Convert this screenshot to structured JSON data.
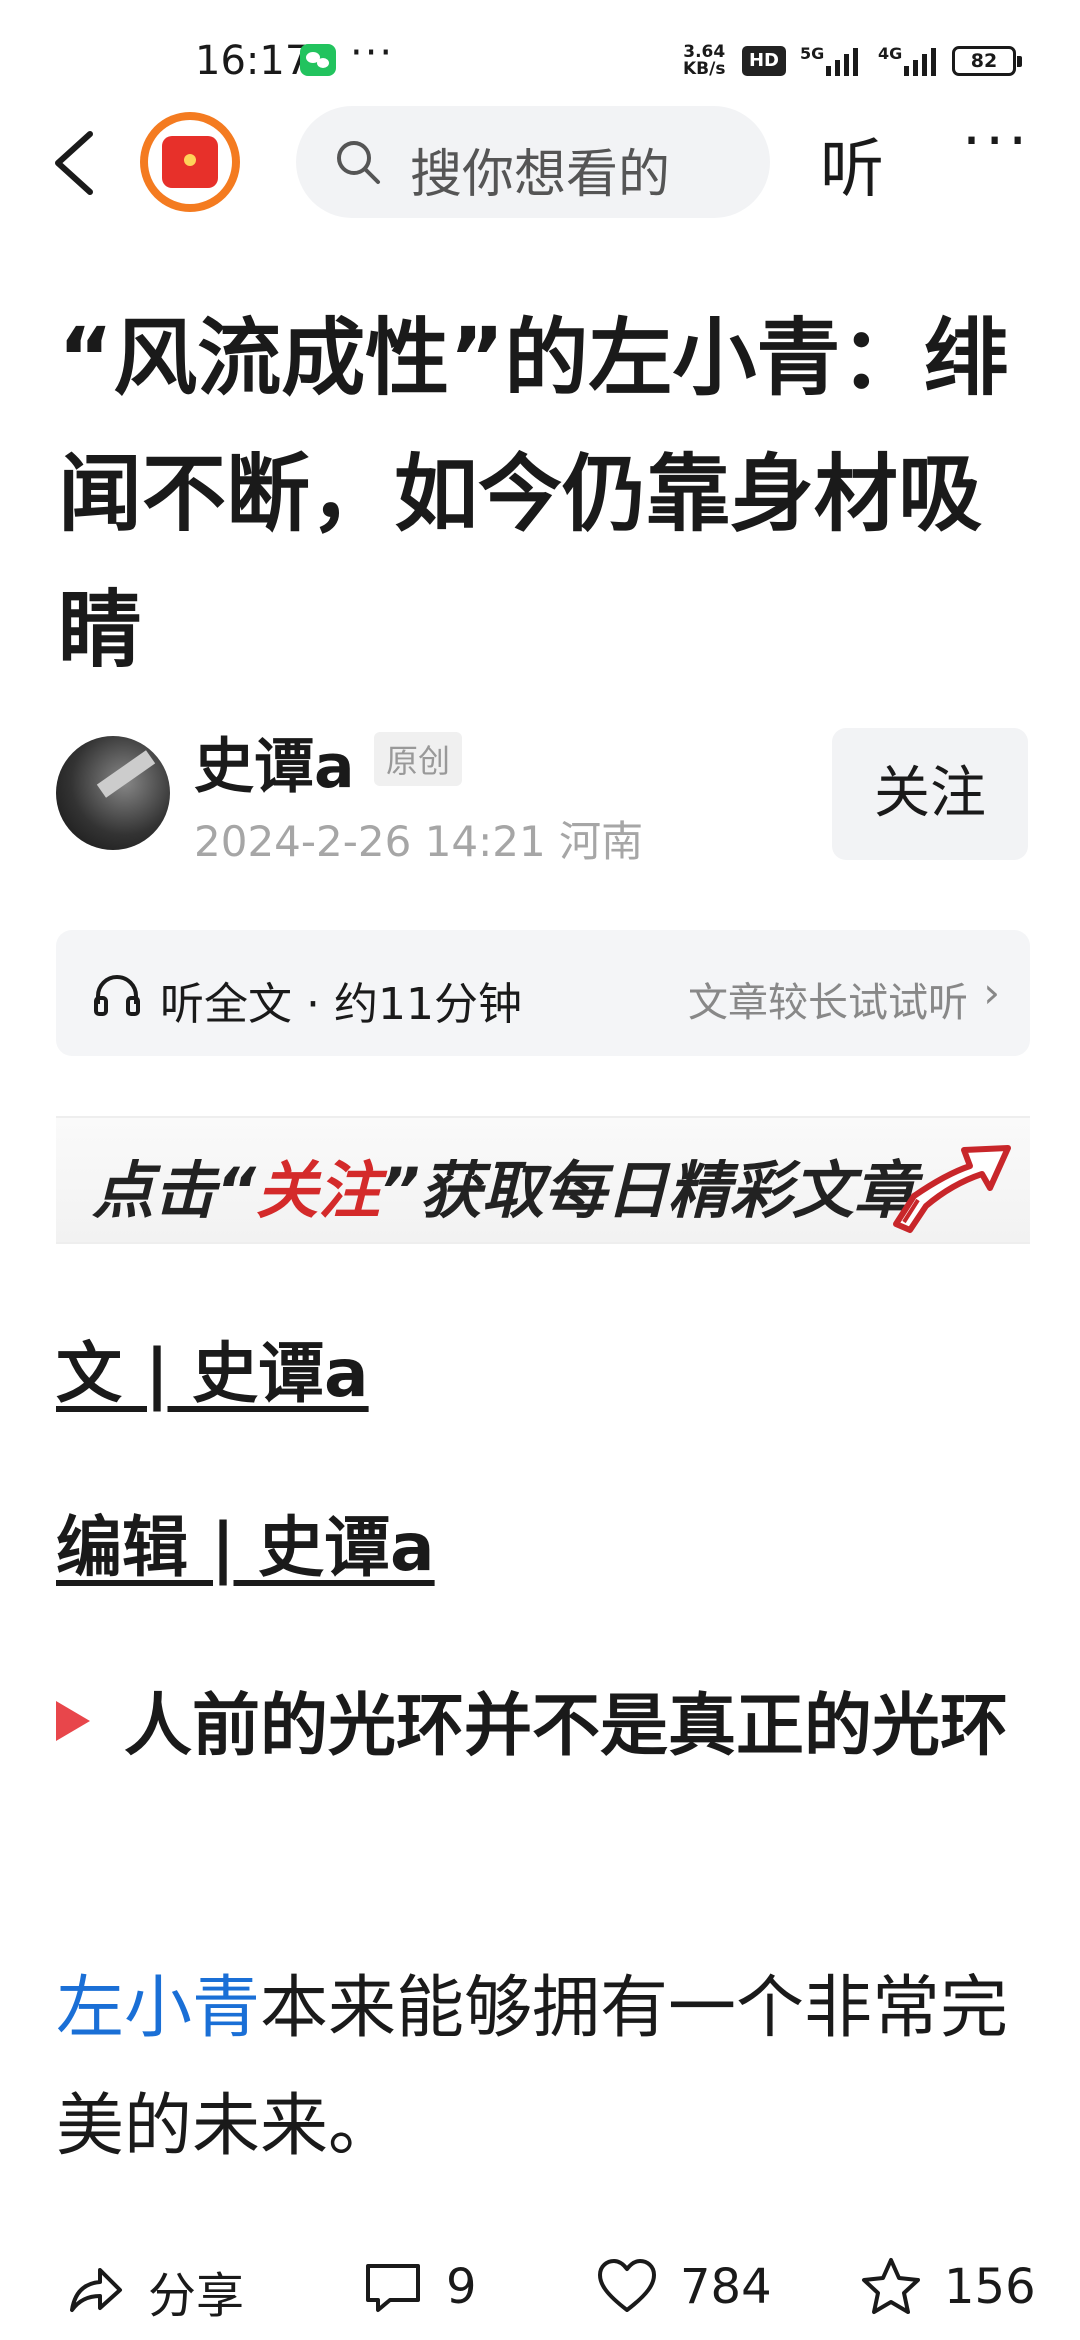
{
  "status_bar": {
    "time": "16:17",
    "more": "···",
    "net_speed_value": "3.64",
    "net_speed_unit": "KB/s",
    "hd_label": "HD",
    "signal1_label": "5G",
    "signal2_label": "4G",
    "battery": "82",
    "icons": [
      "wechat-icon",
      "hd-icon",
      "signal-icon",
      "battery-icon"
    ]
  },
  "nav": {
    "search_placeholder": "搜你想看的",
    "listen_label": "听",
    "more_label": "···",
    "icons": [
      "back-arrow-icon",
      "app-logo-icon",
      "search-icon",
      "more-icon"
    ]
  },
  "article": {
    "title": "“风流成性”的左小青：绯闻不断，如今仍靠身材吸睛",
    "author": "史谭a",
    "original_badge": "原创",
    "meta": "2024-2-26 14:21 河南",
    "follow_label": "关注"
  },
  "listen_bar": {
    "label": "听全文 · 约11分钟",
    "hint": "文章较长试试听",
    "chevron": "›"
  },
  "banner": {
    "prefix": "点击“",
    "highlight": "关注",
    "suffix": "”获取每日精彩文章"
  },
  "body": {
    "byline_writer": "文 | 史谭a",
    "byline_editor": "编辑 | 史谭a",
    "section_heading": "人前的光环并不是真正的光环",
    "paragraph_link": "左小青",
    "paragraph_rest": "本来能够拥有一个非常完美的未来。"
  },
  "bottom_bar": {
    "share_label": "分享",
    "comment_count": "9",
    "like_count": "784",
    "favorite_count": "156"
  },
  "colors": {
    "link_blue": "#1a6fd6",
    "accent_red": "#e8464b",
    "logo_orange": "#f47b20",
    "wechat_green": "#22c35e"
  }
}
